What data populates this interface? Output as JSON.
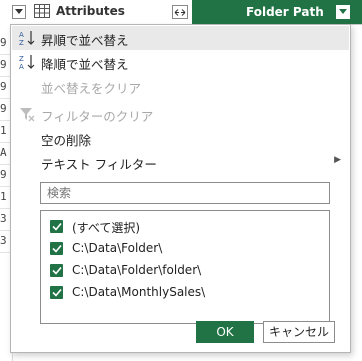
{
  "header": {
    "attributes_label": "Attributes",
    "folder_path_label": "Folder Path",
    "accent_color": "#217346"
  },
  "grid": {
    "row_fragments": [
      "9",
      "9",
      "9",
      "9",
      "1",
      "A",
      "9",
      "1",
      "3",
      "3"
    ]
  },
  "menu": {
    "sort_ascending": "昇順で並べ替え",
    "sort_descending": "降順で並べ替え",
    "clear_sort": "並べ替えをクリア",
    "clear_filter": "フィルターのクリア",
    "remove_empty": "空の削除",
    "text_filters": "テキスト フィルター"
  },
  "search": {
    "placeholder": "検索"
  },
  "list": {
    "items": [
      {
        "label": "(すべて選択)",
        "checked": true
      },
      {
        "label": "C:\\Data\\Folder\\",
        "checked": true
      },
      {
        "label": "C:\\Data\\Folder\\folder\\",
        "checked": true
      },
      {
        "label": "C:\\Data\\MonthlySales\\",
        "checked": true
      }
    ]
  },
  "buttons": {
    "ok": "OK",
    "cancel": "キャンセル"
  }
}
